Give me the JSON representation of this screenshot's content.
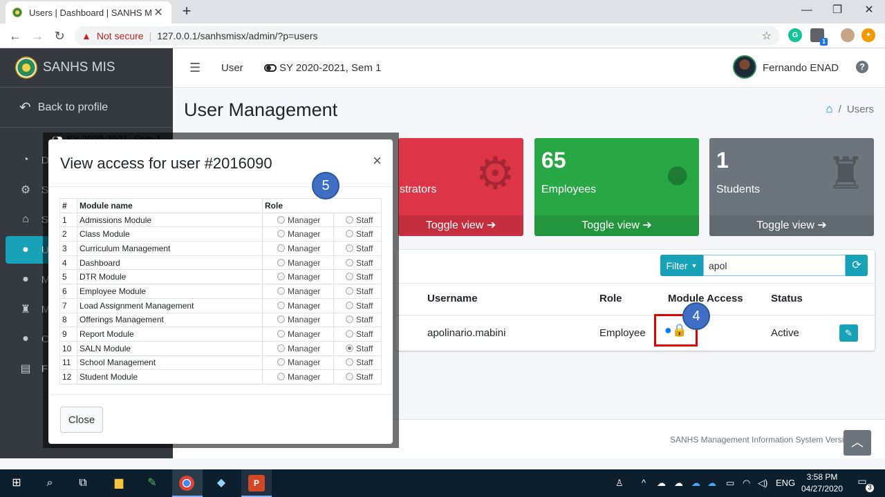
{
  "browser": {
    "tab_title": "Users | Dashboard | SANHS MIS",
    "security": "Not secure",
    "url": "127.0.0.1/sanhsmisx/admin/?p=users",
    "ext_badge": "1"
  },
  "sidebar": {
    "brand": "SANHS MIS",
    "back": "Back to profile",
    "items": [
      {
        "label": "D",
        "icon": "dashboard-icon"
      },
      {
        "label": "S",
        "icon": "cogs-icon"
      },
      {
        "label": "S",
        "icon": "school-icon"
      },
      {
        "label": "U",
        "icon": "user-icon",
        "active": true
      },
      {
        "label": "M",
        "icon": "user-icon"
      },
      {
        "label": "M",
        "icon": "graduation-cap-icon"
      },
      {
        "label": "C",
        "icon": "user-icon"
      },
      {
        "label": "Fi",
        "icon": "file-icon"
      }
    ]
  },
  "topnav": {
    "user_link": "User",
    "school_year": "SY 2020-2021, Sem 1",
    "user_name": "Fernando ENAD",
    "help": "?"
  },
  "content": {
    "page_title": "User Management",
    "breadcrumb": "Users",
    "boxes": [
      {
        "count": "",
        "label": "strators",
        "footer": "Toggle view",
        "color": "#dc3545"
      },
      {
        "count": "65",
        "label": "Employees",
        "footer": "Toggle view",
        "color": "#28a745"
      },
      {
        "count": "1",
        "label": "Students",
        "footer": "Toggle view",
        "color": "#6c757d"
      }
    ],
    "filter_label": "Filter",
    "search_value": "apol",
    "table": {
      "headers": [
        "Username",
        "Role",
        "Module Access",
        "Status"
      ],
      "row": {
        "username": "apolinario.mabini",
        "role": "Employee",
        "status": "Active"
      }
    },
    "footer": "SANHS Management Information System Versic",
    "footer_suffix": "1"
  },
  "modal": {
    "ghost_text": "SY 2020-2021, Sem 1",
    "title": "View access for user #2016090",
    "close_x": "×",
    "headers": [
      "#",
      "Module name",
      "Role"
    ],
    "options": [
      "Manager",
      "Staff"
    ],
    "modules": [
      {
        "num": "1",
        "name": "Admissions Module",
        "selected": ""
      },
      {
        "num": "2",
        "name": "Class Module",
        "selected": ""
      },
      {
        "num": "3",
        "name": "Curriculum Management",
        "selected": ""
      },
      {
        "num": "4",
        "name": "Dashboard",
        "selected": ""
      },
      {
        "num": "5",
        "name": "DTR Module",
        "selected": ""
      },
      {
        "num": "6",
        "name": "Employee Module",
        "selected": ""
      },
      {
        "num": "7",
        "name": "Load Assignment Management",
        "selected": ""
      },
      {
        "num": "8",
        "name": "Offerings Management",
        "selected": ""
      },
      {
        "num": "9",
        "name": "Report Module",
        "selected": ""
      },
      {
        "num": "10",
        "name": "SALN Module",
        "selected": "Staff"
      },
      {
        "num": "11",
        "name": "School Management",
        "selected": ""
      },
      {
        "num": "12",
        "name": "Student Module",
        "selected": ""
      }
    ],
    "close_button": "Close"
  },
  "annotations": {
    "step4": "4",
    "step5": "5"
  },
  "taskbar": {
    "language": "ENG",
    "time": "3:58 PM",
    "date": "04/27/2020",
    "notifications": "3"
  },
  "colors": {
    "accent": "#17a2b8",
    "danger": "#dc3545",
    "success": "#28a745",
    "secondary": "#6c757d",
    "sidebar": "#343a40",
    "highlight": "#e00000",
    "badge": "#3f6fc4"
  }
}
